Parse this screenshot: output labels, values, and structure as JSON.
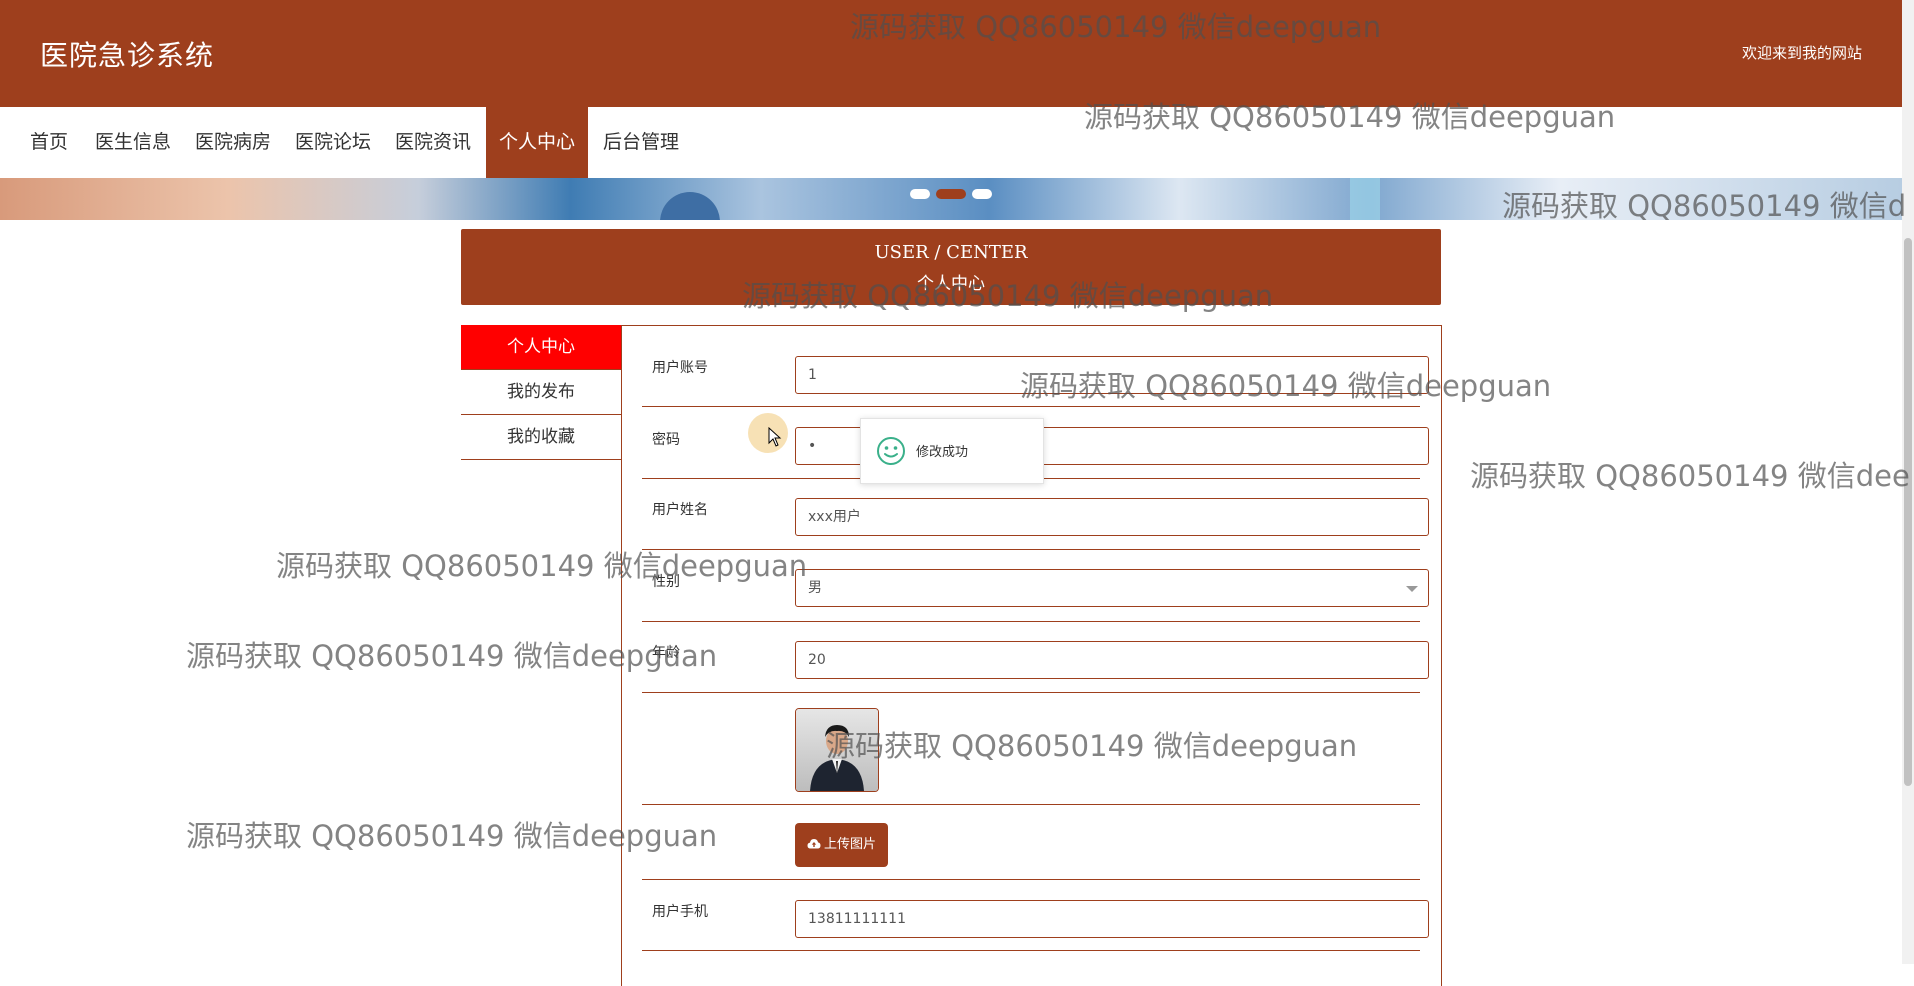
{
  "header": {
    "site_title": "医院急诊系统",
    "welcome": "欢迎来到我的网站"
  },
  "nav": {
    "items": [
      "首页",
      "医生信息",
      "医院病房",
      "医院论坛",
      "医院资讯",
      "个人中心",
      "后台管理"
    ],
    "active_index": 5
  },
  "banner": {
    "slide_count": 3,
    "active_slide": 2
  },
  "user_center": {
    "title_en": "USER / CENTER",
    "title_cn": "个人中心"
  },
  "sidebar": {
    "items": [
      "个人中心",
      "我的发布",
      "我的收藏"
    ],
    "active_index": 0
  },
  "form": {
    "account": {
      "label": "用户账号",
      "value": "1"
    },
    "password": {
      "label": "密码",
      "value": "•"
    },
    "name": {
      "label": "用户姓名",
      "value": "xxx用户"
    },
    "gender": {
      "label": "性别",
      "value": "男"
    },
    "age": {
      "label": "年龄",
      "value": "20"
    },
    "upload_label": "上传图片",
    "phone": {
      "label": "用户手机",
      "value": "13811111111"
    }
  },
  "toast": {
    "message": "修改成功"
  },
  "watermarks": [
    "源码获取 QQ86050149 微信deepguan",
    "源码获取 QQ86050149 微信deepguan",
    "源码获取 QQ86050149 微信d",
    "源码获取 QQ86050149 微信deepguan",
    "源码获取 QQ86050149 微信deepguan",
    "源码获取 QQ86050149 微信dee",
    "源码获取 QQ86050149 微信deepguan",
    "源码获取 QQ86050149 微信deepguan",
    "源码获取 QQ86050149 微信deepguan",
    "源码获取 QQ86050149 微信deepguan"
  ],
  "colors": {
    "brand": "#9e3f1d",
    "sidebar_active": "#ff0000",
    "toast_icon": "#3ab08a"
  }
}
